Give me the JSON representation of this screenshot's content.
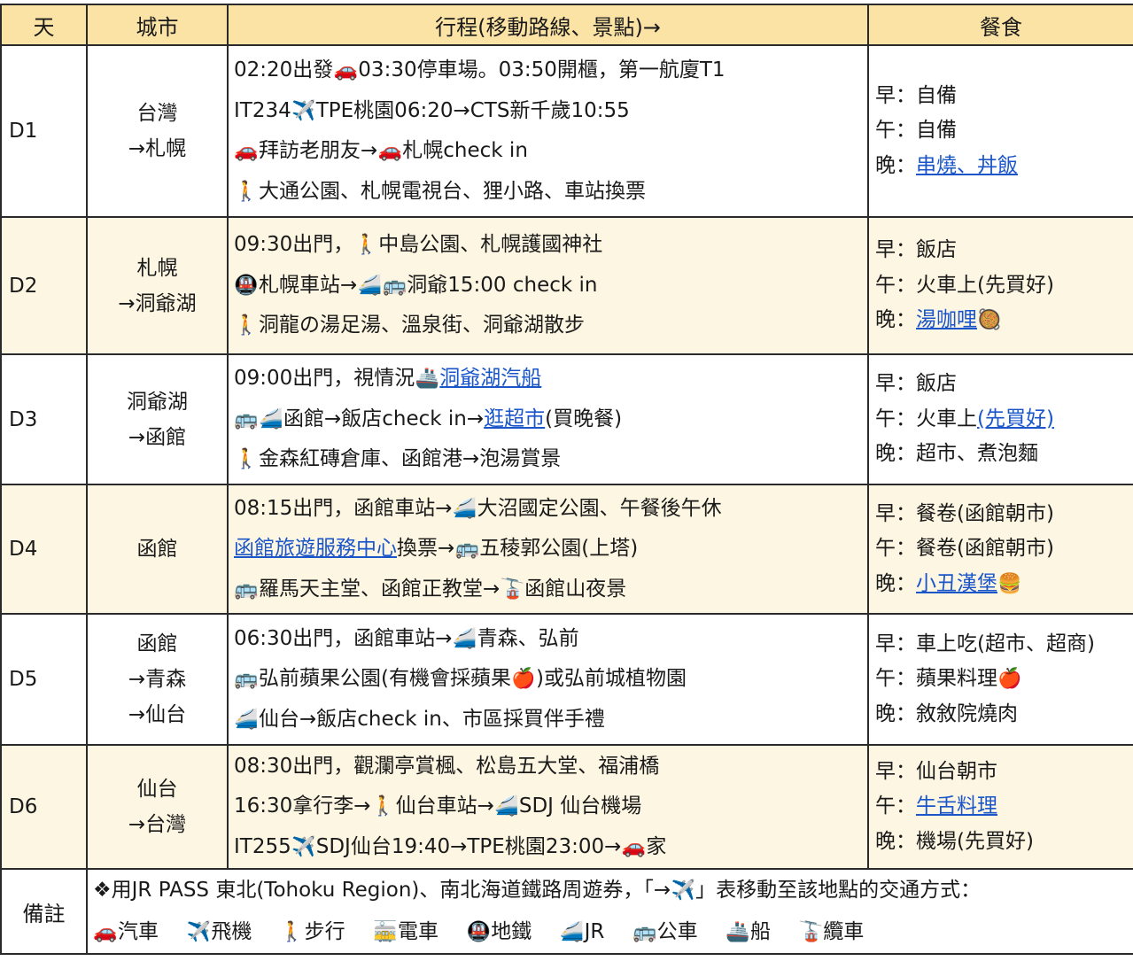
{
  "header": {
    "day": "天",
    "city": "城市",
    "route": "行程(移動路線、景點)→",
    "meal": "餐食"
  },
  "icons": {
    "car": "🚗",
    "plane": "✈️",
    "walk": "🚶",
    "metro": "🚇",
    "jr": "🚄",
    "bus": "🚌",
    "ship": "🚢",
    "rope": "🚡",
    "train": "🚋",
    "apple": "🍎",
    "burger": "🍔",
    "curry": "🥘"
  },
  "rows": [
    {
      "day": "D1",
      "city1": "台灣",
      "city2": "→札幌",
      "r1": {
        "a": "02:20出發",
        "b": "03:30停車場。03:50開櫃，第一航廈T1"
      },
      "r2": {
        "a": "IT234",
        "b": "TPE桃園06:20→CTS新千歲10:55"
      },
      "r3": {
        "a": "拜訪老朋友→",
        "b": "札幌check in"
      },
      "r4": {
        "a": "大通公園、札幌電視台、狸小路、車站換票"
      },
      "m1": "早：自備",
      "m2": "午：自備",
      "m3pre": "晚：",
      "m3link": "串燒、丼飯"
    },
    {
      "day": "D2",
      "city1": "札幌",
      "city2": "→洞爺湖",
      "r1": {
        "a": "09:30出門，",
        "b": "中島公園、札幌護國神社"
      },
      "r2": {
        "a": "札幌車站→",
        "b": "洞爺15:00 check in"
      },
      "r3": {
        "a": "洞龍の湯足湯、溫泉街、洞爺湖散步"
      },
      "m1": "早：飯店",
      "m2": "午：火車上(先買好)",
      "m3pre": "晚：",
      "m3link": "湯咖哩"
    },
    {
      "day": "D3",
      "city1": "洞爺湖",
      "city2": "→函館",
      "r1": {
        "a": "09:00出門，視情況",
        "link": "洞爺湖汽船"
      },
      "r2": {
        "a": "函館→飯店check in→",
        "link": "逛超市",
        "b": "(買晚餐)"
      },
      "r3": {
        "a": "金森紅磚倉庫、函館港→泡湯賞景"
      },
      "m1": "早：飯店",
      "m2pre": "午：火車上",
      "m2link": "(先買好)",
      "m3": "晚：超市、煮泡麵"
    },
    {
      "day": "D4",
      "city1": "函館",
      "r1": {
        "a": "08:15出門，函館車站→",
        "b": "大沼國定公園、午餐後午休"
      },
      "r2": {
        "link": "函館旅遊服務中心",
        "a": "換票→",
        "b": "五稜郭公園(上塔)"
      },
      "r3": {
        "a": "羅馬天主堂、函館正教堂→",
        "b": "函館山夜景"
      },
      "m1": "早：餐卷(函館朝市)",
      "m2": "午：餐卷(函館朝市)",
      "m3pre": "晚：",
      "m3link": "小丑漢堡"
    },
    {
      "day": "D5",
      "city1": "函館",
      "city2": "→青森",
      "city3": "→仙台",
      "r1": {
        "a": "06:30出門，函館車站→",
        "b": "青森、弘前"
      },
      "r2": {
        "a": "弘前蘋果公園(有機會採蘋果",
        "b": ")或弘前城植物園"
      },
      "r3": {
        "a": "仙台→飯店check in、市區採買伴手禮"
      },
      "m1": "早：車上吃(超市、超商)",
      "m2": "午：蘋果料理",
      "m3": "晚：敘敘院燒肉"
    },
    {
      "day": "D6",
      "city1": "仙台",
      "city2": "→台灣",
      "r1": {
        "a": "08:30出門，觀瀾亭賞楓、松島五大堂、福浦橋"
      },
      "r2": {
        "a": "16:30拿行李→",
        "b": "仙台車站→",
        "c": "SDJ 仙台機場"
      },
      "r3": {
        "a": "IT255",
        "b": "SDJ仙台19:40→TPE桃園23:00→",
        "c": "家"
      },
      "m1": "早：仙台朝市",
      "m2pre": "午：",
      "m2link": "牛舌料理",
      "m3": "晚：機場(先買好)"
    }
  ],
  "note": {
    "label": "備註",
    "line1a": "❖用JR PASS 東北(Tohoku Region)、南北海道鐵路周遊券，「→",
    "line1b": "」表移動至該地點的交通方式：",
    "legend": [
      "汽車",
      "飛機",
      "步行",
      "電車",
      "地鐵",
      "JR",
      "公車",
      "船",
      "纜車"
    ]
  }
}
